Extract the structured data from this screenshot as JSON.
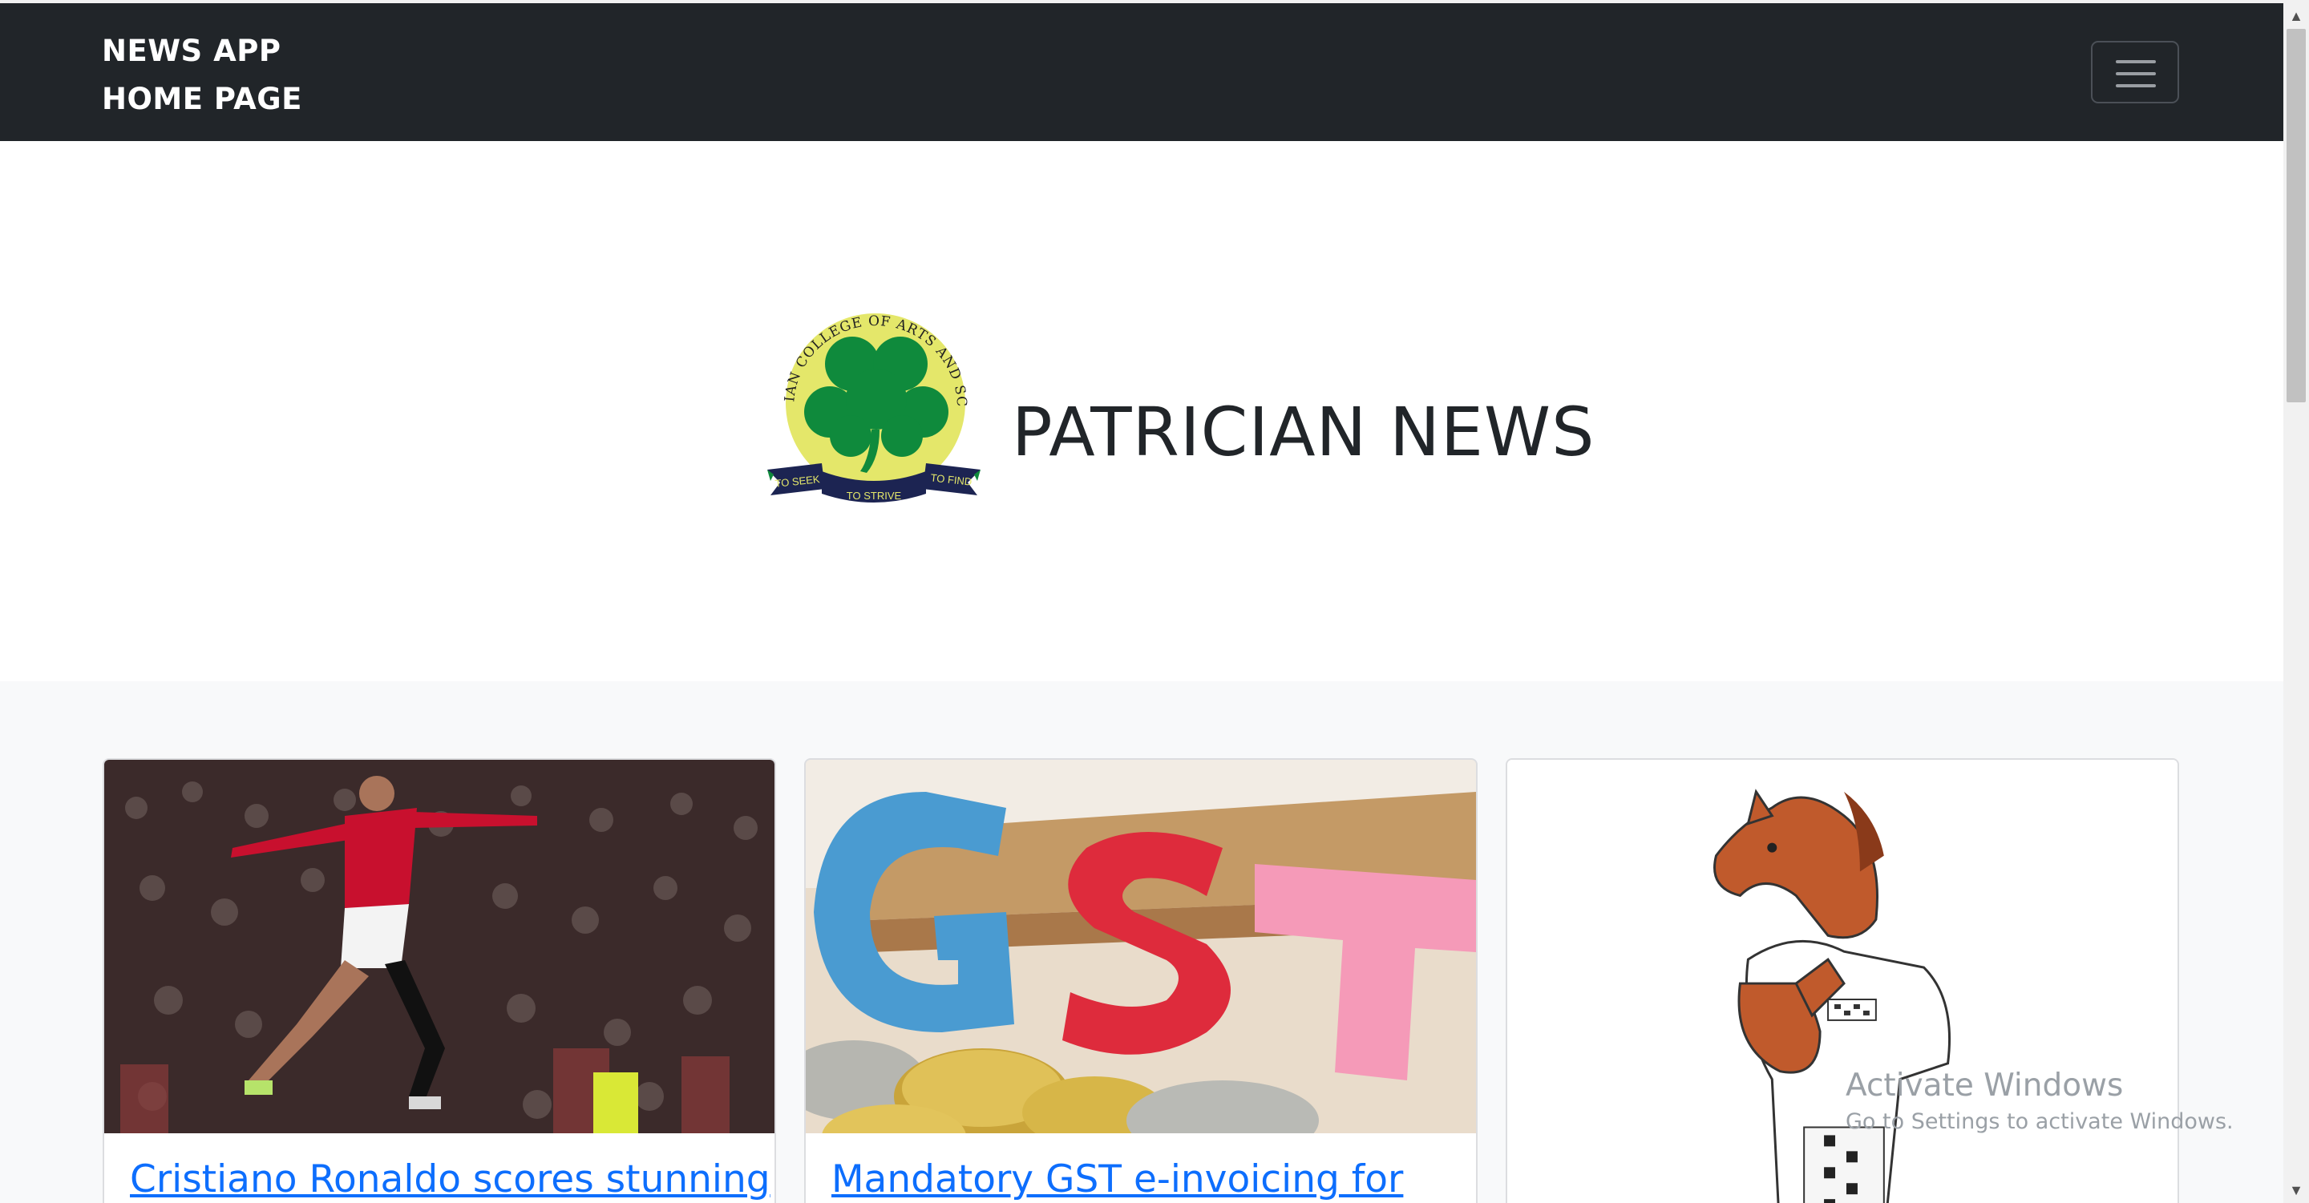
{
  "navbar": {
    "brand_line1": "NEWS APP",
    "brand_line2": "HOME PAGE",
    "toggler_icon": "hamburger-menu-icon",
    "background": "#212529"
  },
  "hero": {
    "logo_text_arc": "PATRICIAN COLLEGE OF ARTS AND SCIENCE",
    "logo_ribbon_left": "TO SEEK",
    "logo_ribbon_center": "TO STRIVE",
    "logo_ribbon_right": "TO FIND",
    "title": "PATRICIAN NEWS"
  },
  "cards": [
    {
      "title": "Cristiano Ronaldo scores stunning",
      "image": "footballer-celebrating-photo"
    },
    {
      "title": "Mandatory GST e-invoicing for",
      "image": "gst-letters-coins-photo"
    },
    {
      "title": "",
      "image": "horse-mascot-cricket-illustration"
    }
  ],
  "watermark": {
    "title": "Activate Windows",
    "subtitle": "Go to Settings to activate Windows."
  },
  "colors": {
    "link": "#0d6efd",
    "section_bg": "#f8f9fa",
    "logo_green": "#0f8a3c",
    "logo_yellow": "#e4e76a",
    "ribbon_navy": "#1c2452"
  }
}
